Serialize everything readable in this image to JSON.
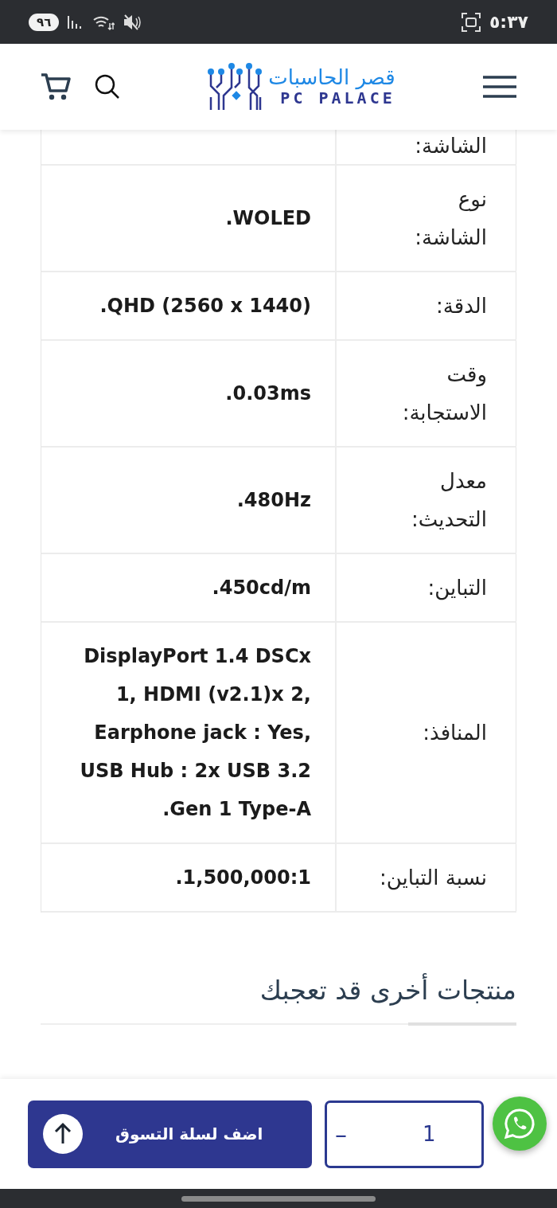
{
  "status_bar": {
    "time": "٥:٣٧",
    "battery": "٩٦"
  },
  "header": {
    "logo_arabic": "قصر الحاسبات",
    "logo_latin": "PC PALACE"
  },
  "specs": [
    {
      "label": "الشاشة:"
    },
    {
      "label": "نوع الشاشة:",
      "value": "WOLED."
    },
    {
      "label": "الدقة:",
      "value": "QHD (2560 x 1440)."
    },
    {
      "label": "وقت الاستجابة:",
      "value": "0.03ms."
    },
    {
      "label": "معدل التحديث:",
      "value": "480Hz."
    },
    {
      "label": "التباين:",
      "value": "450cd/m."
    },
    {
      "label": "المنافذ:",
      "value": "DisplayPort 1.4 DSCx 1, HDMI (v2.1)x 2, Earphone jack : Yes, USB Hub : 2x USB 3.2 Gen 1 Type-A."
    },
    {
      "label": "نسبة التباين:",
      "value": "1,500,000:1."
    }
  ],
  "related": {
    "title": "منتجات أخرى قد تعجبك"
  },
  "cart_bar": {
    "add_button": "اضف لسلة التسوق",
    "quantity": "1",
    "minus": "–"
  }
}
